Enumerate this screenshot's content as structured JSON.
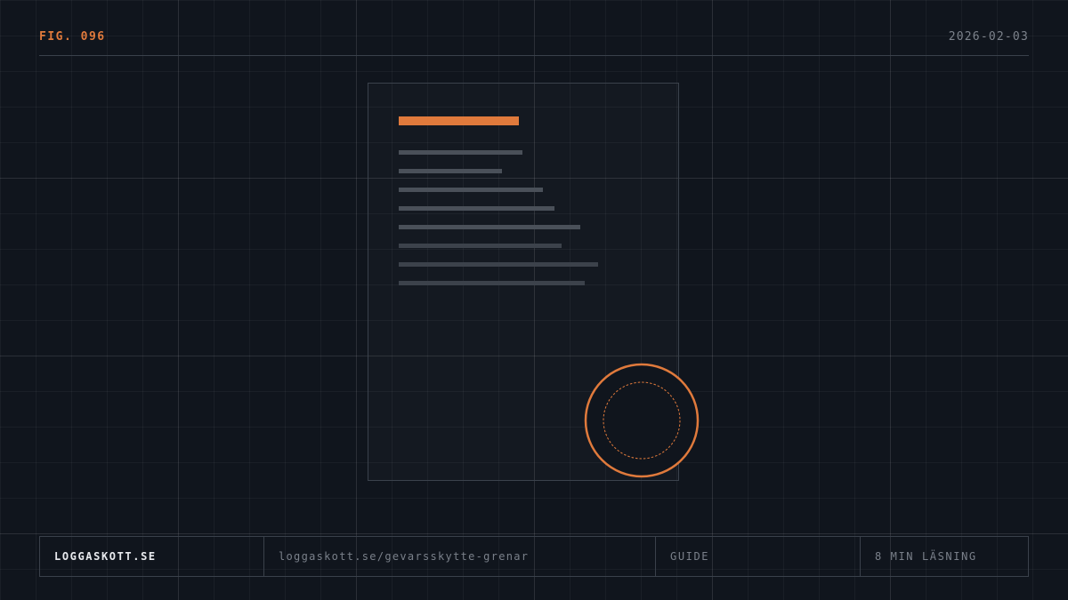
{
  "header": {
    "figure_label": "FIG. 096",
    "date": "2026-02-03"
  },
  "document_illustration": {
    "icon": "document-icon",
    "accent_color": "#e07a3c"
  },
  "seal": {
    "icon": "seal-stamp-icon",
    "color": "#e07a3c"
  },
  "footer": {
    "brand": "LOGGASKOTT.SE",
    "url": "loggaskott.se/gevarsskytte-grenar",
    "category": "GUIDE",
    "reading_time": "8 MIN LÄSNING"
  },
  "colors": {
    "background": "#10151d",
    "accent": "#e07a3c",
    "muted_text": "#7d838c",
    "border": "#3a414b"
  }
}
